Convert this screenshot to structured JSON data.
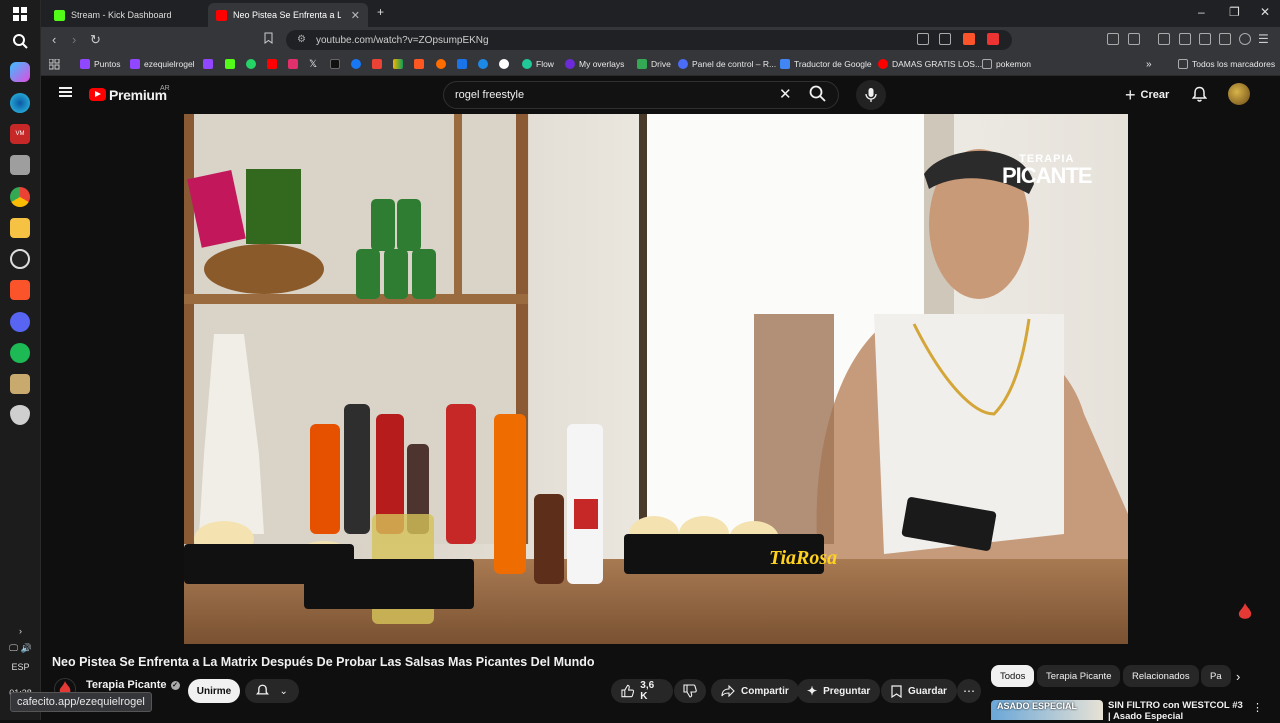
{
  "taskbar": {
    "icons": [
      "windows-start",
      "search",
      "copilot",
      "edge",
      "voicemeeter",
      "explorer",
      "chrome",
      "folder",
      "obs",
      "brave",
      "discord",
      "spotify",
      "league",
      "shield"
    ],
    "clock": "01:38",
    "lang": "ESP"
  },
  "tabs": [
    {
      "title": "Stream - Kick Dashboard",
      "active": false,
      "color": "#53fc18"
    },
    {
      "title": "Neo Pistea Se Enfrenta a La M",
      "active": true,
      "color": "#ff0000"
    }
  ],
  "address": {
    "url": "youtube.com/watch?v=ZOpsumpEKNg"
  },
  "bookmarks": [
    {
      "label": "Puntos",
      "color": "#9146ff"
    },
    {
      "label": "ezequielrogel",
      "color": "#9146ff"
    },
    {
      "label": "",
      "color": "#9146ff"
    },
    {
      "label": "",
      "color": "#53fc18"
    },
    {
      "label": "",
      "color": "#25d366"
    },
    {
      "label": "",
      "color": "#ff0000"
    },
    {
      "label": "",
      "color": "#e1306c"
    },
    {
      "label": "",
      "color": "#ffffff"
    },
    {
      "label": "",
      "color": "#000000"
    },
    {
      "label": "",
      "color": "#1877f2"
    },
    {
      "label": "",
      "color": "#ea4335"
    },
    {
      "label": "",
      "color": "#f4b400"
    },
    {
      "label": "",
      "color": "#ff5722"
    },
    {
      "label": "",
      "color": "#ff6d00"
    },
    {
      "label": "",
      "color": "#1a73e8"
    },
    {
      "label": "",
      "color": "#ffffff"
    },
    {
      "label": "Flow",
      "color": "#20c997"
    },
    {
      "label": "My overlays",
      "color": "#6c2bd9"
    },
    {
      "label": "Drive",
      "color": "#34a853"
    },
    {
      "label": "Panel de control – R...",
      "color": "#4a6cf7"
    },
    {
      "label": "Traductor de Google",
      "color": "#4285f4"
    },
    {
      "label": "DAMAS GRATIS LOS...",
      "color": "#ff0000"
    },
    {
      "label": "pokemon",
      "color": "#555555"
    }
  ],
  "bookmarks_all": "Todos los marcadores",
  "youtube": {
    "brand": "Premium",
    "country": "AR",
    "search_value": "rogel freestyle",
    "create_label": "Crear"
  },
  "video": {
    "overlay_line1": "TERAPIA",
    "overlay_line2": "PICANTE",
    "title": "Neo Pistea Se Enfrenta a La Matrix Después De Probar Las Salsas Mas Picantes Del Mundo",
    "channel": "Terapia Picante",
    "join_label": "Unirme",
    "likes": "3,6 K",
    "share_label": "Compartir",
    "ask_label": "Preguntar",
    "save_label": "Guardar"
  },
  "chips": [
    "Todos",
    "Terapia Picante",
    "Relacionados",
    "Pa"
  ],
  "recommendation": {
    "thumb_text": "ASADO ESPECIAL",
    "title": "SIN FILTRO con WESTCOL #3 | Asado Especial"
  },
  "status_url": "cafecito.app/ezequielrogel"
}
